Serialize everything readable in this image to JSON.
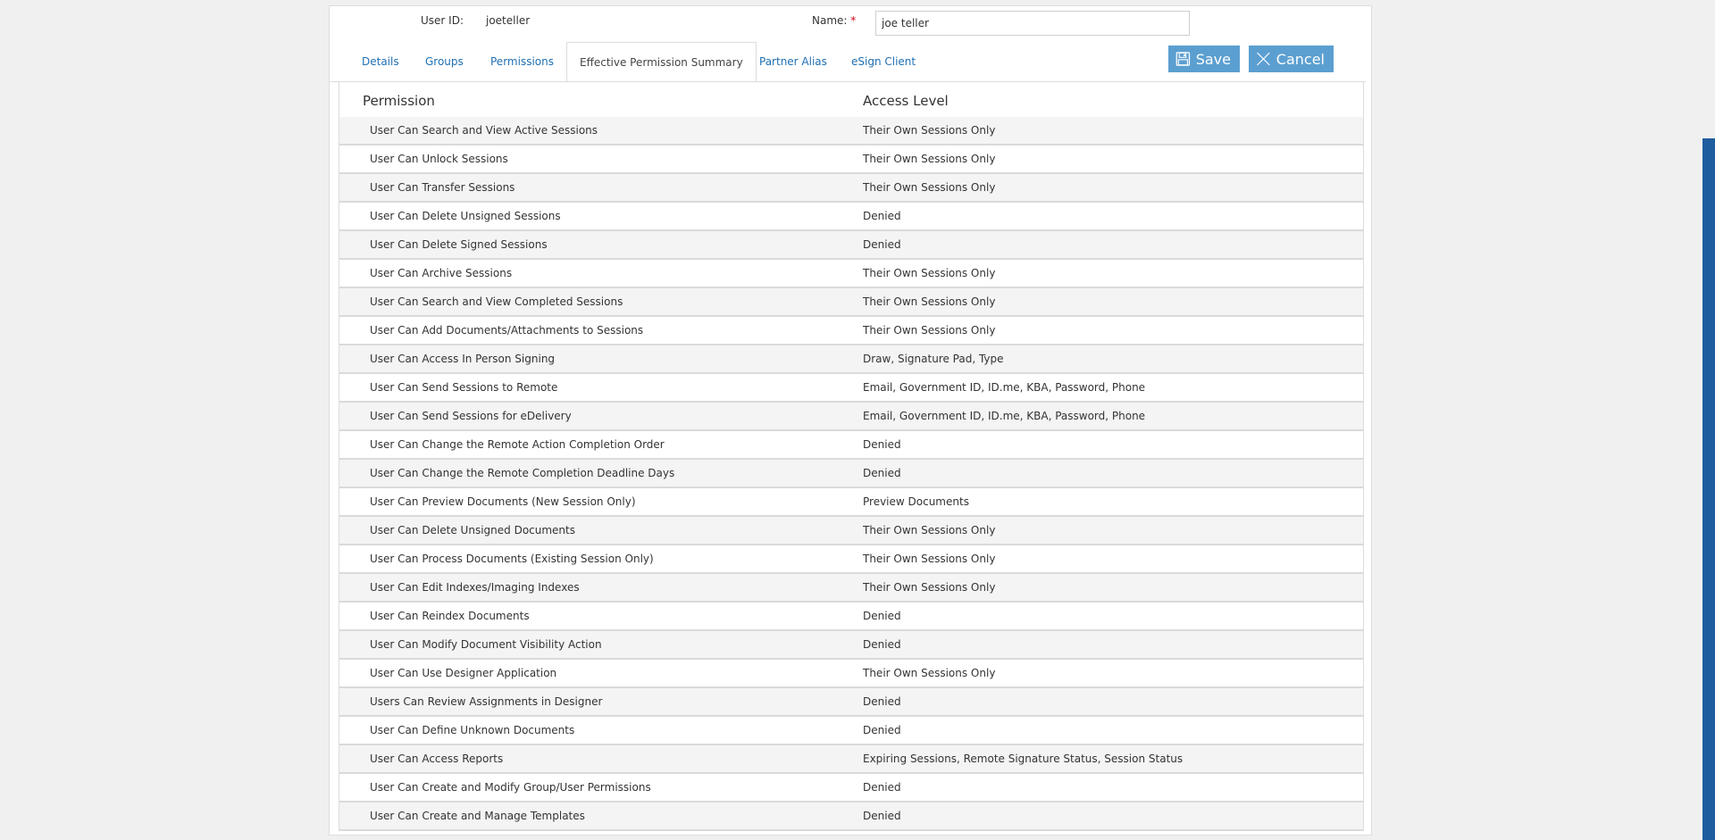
{
  "header": {
    "user_id_label": "User ID:",
    "user_id_value": "joeteller",
    "name_label": "Name:",
    "name_required_mark": "*",
    "name_value": "joe teller"
  },
  "tabs": [
    {
      "label": "Details",
      "active": false
    },
    {
      "label": "Groups",
      "active": false
    },
    {
      "label": "Permissions",
      "active": false
    },
    {
      "label": "Effective Permission Summary",
      "active": true
    },
    {
      "label": "Partner Alias",
      "active": false
    },
    {
      "label": "eSign Client",
      "active": false
    }
  ],
  "actions": {
    "save_label": "Save",
    "cancel_label": "Cancel",
    "save_icon": "floppy-disk-icon",
    "cancel_icon": "close-icon"
  },
  "table": {
    "columns": [
      "Permission",
      "Access Level"
    ],
    "rows": [
      [
        "User Can Search and View Active Sessions",
        "Their Own Sessions Only"
      ],
      [
        "User Can Unlock Sessions",
        "Their Own Sessions Only"
      ],
      [
        "User Can Transfer Sessions",
        "Their Own Sessions Only"
      ],
      [
        "User Can Delete Unsigned Sessions",
        "Denied"
      ],
      [
        "User Can Delete Signed Sessions",
        "Denied"
      ],
      [
        "User Can Archive Sessions",
        "Their Own Sessions Only"
      ],
      [
        "User Can Search and View Completed Sessions",
        "Their Own Sessions Only"
      ],
      [
        "User Can Add Documents/Attachments to Sessions",
        "Their Own Sessions Only"
      ],
      [
        "User Can Access In Person Signing",
        "Draw, Signature Pad, Type"
      ],
      [
        "User Can Send Sessions to Remote",
        "Email, Government ID, ID.me, KBA, Password, Phone"
      ],
      [
        "User Can Send Sessions for eDelivery",
        "Email, Government ID, ID.me, KBA, Password, Phone"
      ],
      [
        "User Can Change the Remote Action Completion Order",
        "Denied"
      ],
      [
        "User Can Change the Remote Completion Deadline Days",
        "Denied"
      ],
      [
        "User Can Preview Documents (New Session Only)",
        "Preview Documents"
      ],
      [
        "User Can Delete Unsigned Documents",
        "Their Own Sessions Only"
      ],
      [
        "User Can Process Documents (Existing Session Only)",
        "Their Own Sessions Only"
      ],
      [
        "User Can Edit Indexes/Imaging Indexes",
        "Their Own Sessions Only"
      ],
      [
        "User Can Reindex Documents",
        "Denied"
      ],
      [
        "User Can Modify Document Visibility Action",
        "Denied"
      ],
      [
        "User Can Use Designer Application",
        "Their Own Sessions Only"
      ],
      [
        "Users Can Review Assignments in Designer",
        "Denied"
      ],
      [
        "User Can Define Unknown Documents",
        "Denied"
      ],
      [
        "User Can Access Reports",
        "Expiring Sessions, Remote Signature Status, Session Status"
      ],
      [
        "User Can Create and Modify Group/User Permissions",
        "Denied"
      ],
      [
        "User Can Create and Manage Templates",
        "Denied"
      ]
    ]
  },
  "colors": {
    "accent": "#5b9fd1",
    "link": "#1f6fb2",
    "required": "#d0021b",
    "scroll_accent": "#1e5e9e"
  }
}
